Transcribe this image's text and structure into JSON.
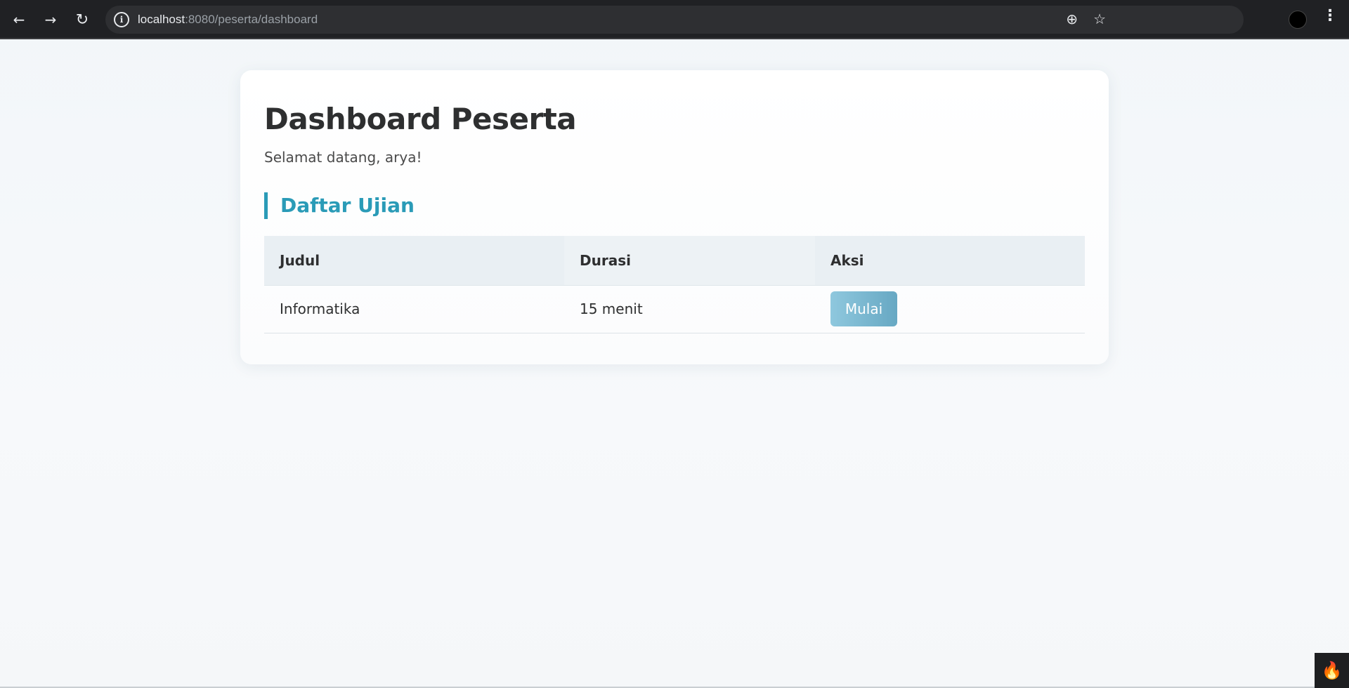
{
  "browser": {
    "url_host": "localhost",
    "url_path": ":8080/peserta/dashboard",
    "back_icon": "arrow-left",
    "forward_icon": "arrow-right",
    "reload_icon": "reload",
    "info_icon": "i",
    "zoom_icon": "zoom-in",
    "bookmark_icon": "star"
  },
  "page": {
    "title": "Dashboard Peserta",
    "welcome": "Selamat datang, arya!",
    "section_title": "Daftar Ujian",
    "accent_color": "#2a9bb7"
  },
  "table": {
    "headers": [
      "Judul",
      "Durasi",
      "Aksi"
    ],
    "rows": [
      {
        "judul": "Informatika",
        "durasi": "15 menit",
        "action_label": "Mulai"
      }
    ]
  },
  "debug_toolbar": {
    "icon": "flame"
  }
}
